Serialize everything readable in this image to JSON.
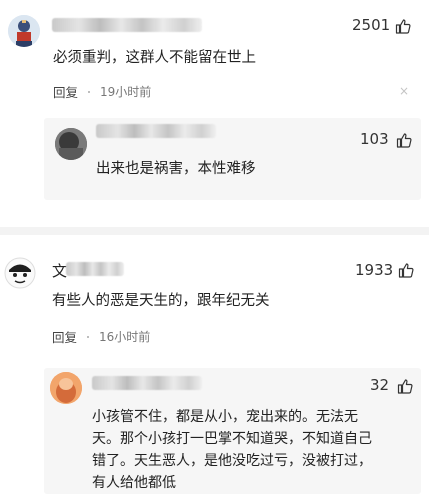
{
  "comments": [
    {
      "likes": "2501",
      "text": "必须重判，这群人不能留在世上",
      "reply_label": "回复",
      "time": "19小时前",
      "reply": {
        "likes": "103",
        "text": "出来也是祸害，本性难移"
      }
    },
    {
      "name_prefix": "文",
      "likes": "1933",
      "text": "有些人的恶是天生的，跟年纪无关",
      "reply_label": "回复",
      "time": "16小时前",
      "reply": {
        "likes": "32",
        "lines": [
          "小孩管不住，都是从小，宠出来的。无法无",
          "天。那个小孩打一巴掌不知道哭，不知道自己",
          "错了。天生恶人，是他没吃过亏，没被打过，",
          "有人给他都低"
        ]
      }
    }
  ],
  "icons": {
    "like": "thumbs-up-icon",
    "close": "close-icon"
  }
}
